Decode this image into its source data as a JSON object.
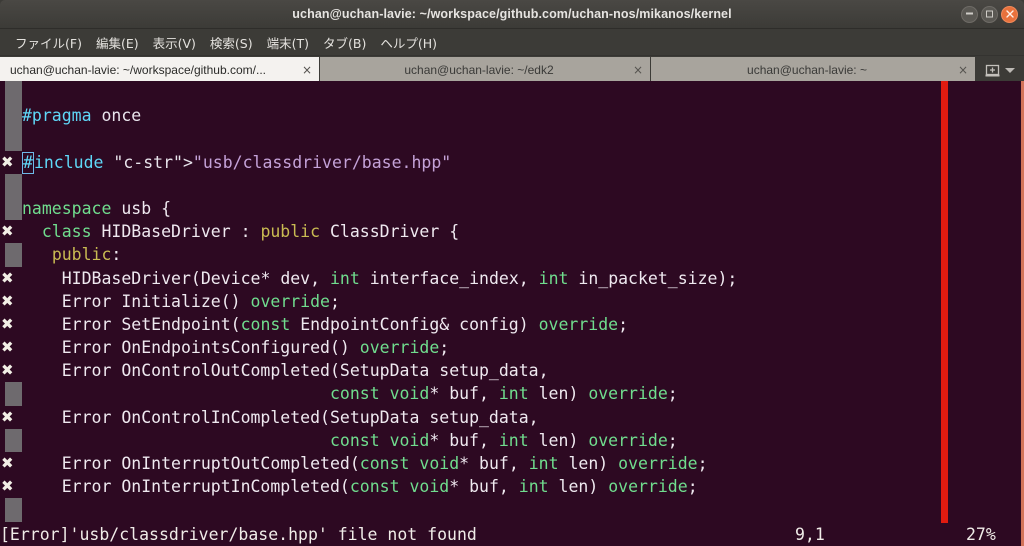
{
  "window": {
    "title": "uchan@uchan-lavie: ~/workspace/github.com/uchan-nos/mikanos/kernel",
    "controls": [
      {
        "name": "minimize",
        "label": "–"
      },
      {
        "name": "maximize",
        "label": "□"
      },
      {
        "name": "close",
        "label": "×"
      }
    ]
  },
  "menubar": {
    "items": [
      {
        "label": "ファイル(F)"
      },
      {
        "label": "編集(E)"
      },
      {
        "label": "表示(V)"
      },
      {
        "label": "検索(S)"
      },
      {
        "label": "端末(T)"
      },
      {
        "label": "タブ(B)"
      },
      {
        "label": "ヘルプ(H)"
      }
    ]
  },
  "tabbar": {
    "tabs": [
      {
        "label": "uchan@uchan-lavie: ~/workspace/github.com/...",
        "close": "×",
        "active": true
      },
      {
        "label": "uchan@uchan-lavie: ~/edk2",
        "close": "×",
        "active": false
      },
      {
        "label": "uchan@uchan-lavie: ~",
        "close": "×",
        "active": false
      }
    ],
    "new_tab_icon": "new-tab-icon",
    "menu_icon": "chevron-down-icon"
  },
  "editor": {
    "colors": {
      "background": "#2d0922",
      "preprocessor": "#5fd7f7",
      "string": "#c4a2d8",
      "keyword": "#70dd8e",
      "access": "#c9bb52",
      "text": "#efe9f0",
      "column_guide": "#e01b10",
      "sign_column": "#6e6a6e",
      "cursor_border": "#6fb9e8"
    },
    "error_mark": "✖",
    "lines": [
      {
        "mark": "none",
        "text": ""
      },
      {
        "mark": "none",
        "text": "#pragma once"
      },
      {
        "mark": "none",
        "text": ""
      },
      {
        "mark": "error",
        "text": "#include \"usb/classdriver/base.hpp\""
      },
      {
        "mark": "none",
        "text": ""
      },
      {
        "mark": "none",
        "text": "namespace usb {"
      },
      {
        "mark": "error",
        "text": "  class HIDBaseDriver : public ClassDriver {"
      },
      {
        "mark": "none",
        "text": "   public:"
      },
      {
        "mark": "error",
        "text": "    HIDBaseDriver(Device* dev, int interface_index, int in_packet_size);"
      },
      {
        "mark": "error",
        "text": "    Error Initialize() override;"
      },
      {
        "mark": "error",
        "text": "    Error SetEndpoint(const EndpointConfig& config) override;"
      },
      {
        "mark": "error",
        "text": "    Error OnEndpointsConfigured() override;"
      },
      {
        "mark": "error",
        "text": "    Error OnControlOutCompleted(SetupData setup_data,"
      },
      {
        "mark": "none",
        "text": "                               const void* buf, int len) override;"
      },
      {
        "mark": "error",
        "text": "    Error OnControlInCompleted(SetupData setup_data,"
      },
      {
        "mark": "none",
        "text": "                               const void* buf, int len) override;"
      },
      {
        "mark": "error",
        "text": "    Error OnInterruptOutCompleted(const void* buf, int len) override;"
      },
      {
        "mark": "error",
        "text": "    Error OnInterruptInCompleted(const void* buf, int len) override;"
      },
      {
        "mark": "none",
        "text": ""
      }
    ]
  },
  "statusline": {
    "message": "[Error]'usb/classdriver/base.hpp' file not found",
    "position": "9,1",
    "percent": "27%"
  }
}
